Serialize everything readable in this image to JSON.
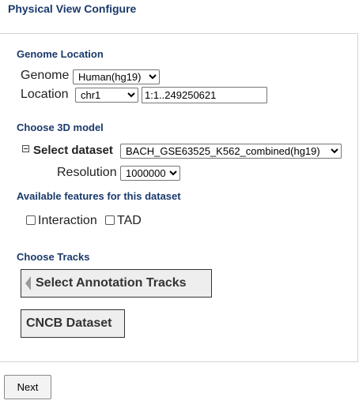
{
  "page": {
    "title": "Physical View Configure"
  },
  "genome_location": {
    "heading": "Genome Location",
    "genome_label": "Genome",
    "genome_value": "Human(hg19)",
    "location_label": "Location",
    "chromosome_value": "chr1",
    "range_value": "1:1..249250621"
  },
  "model": {
    "heading": "Choose 3D model",
    "dataset_label": "Select dataset",
    "dataset_value": "BACH_GSE63525_K562_combined(hg19)",
    "resolution_label": "Resolution",
    "resolution_value": "1000000"
  },
  "features": {
    "heading": "Available features for this dataset",
    "interaction_label": "Interaction",
    "interaction_checked": false,
    "tad_label": "TAD",
    "tad_checked": false
  },
  "tracks": {
    "heading": "Choose Tracks",
    "annotation_button": "Select Annotation Tracks",
    "cncb_button": "CNCB Dataset"
  },
  "actions": {
    "next_label": "Next"
  }
}
